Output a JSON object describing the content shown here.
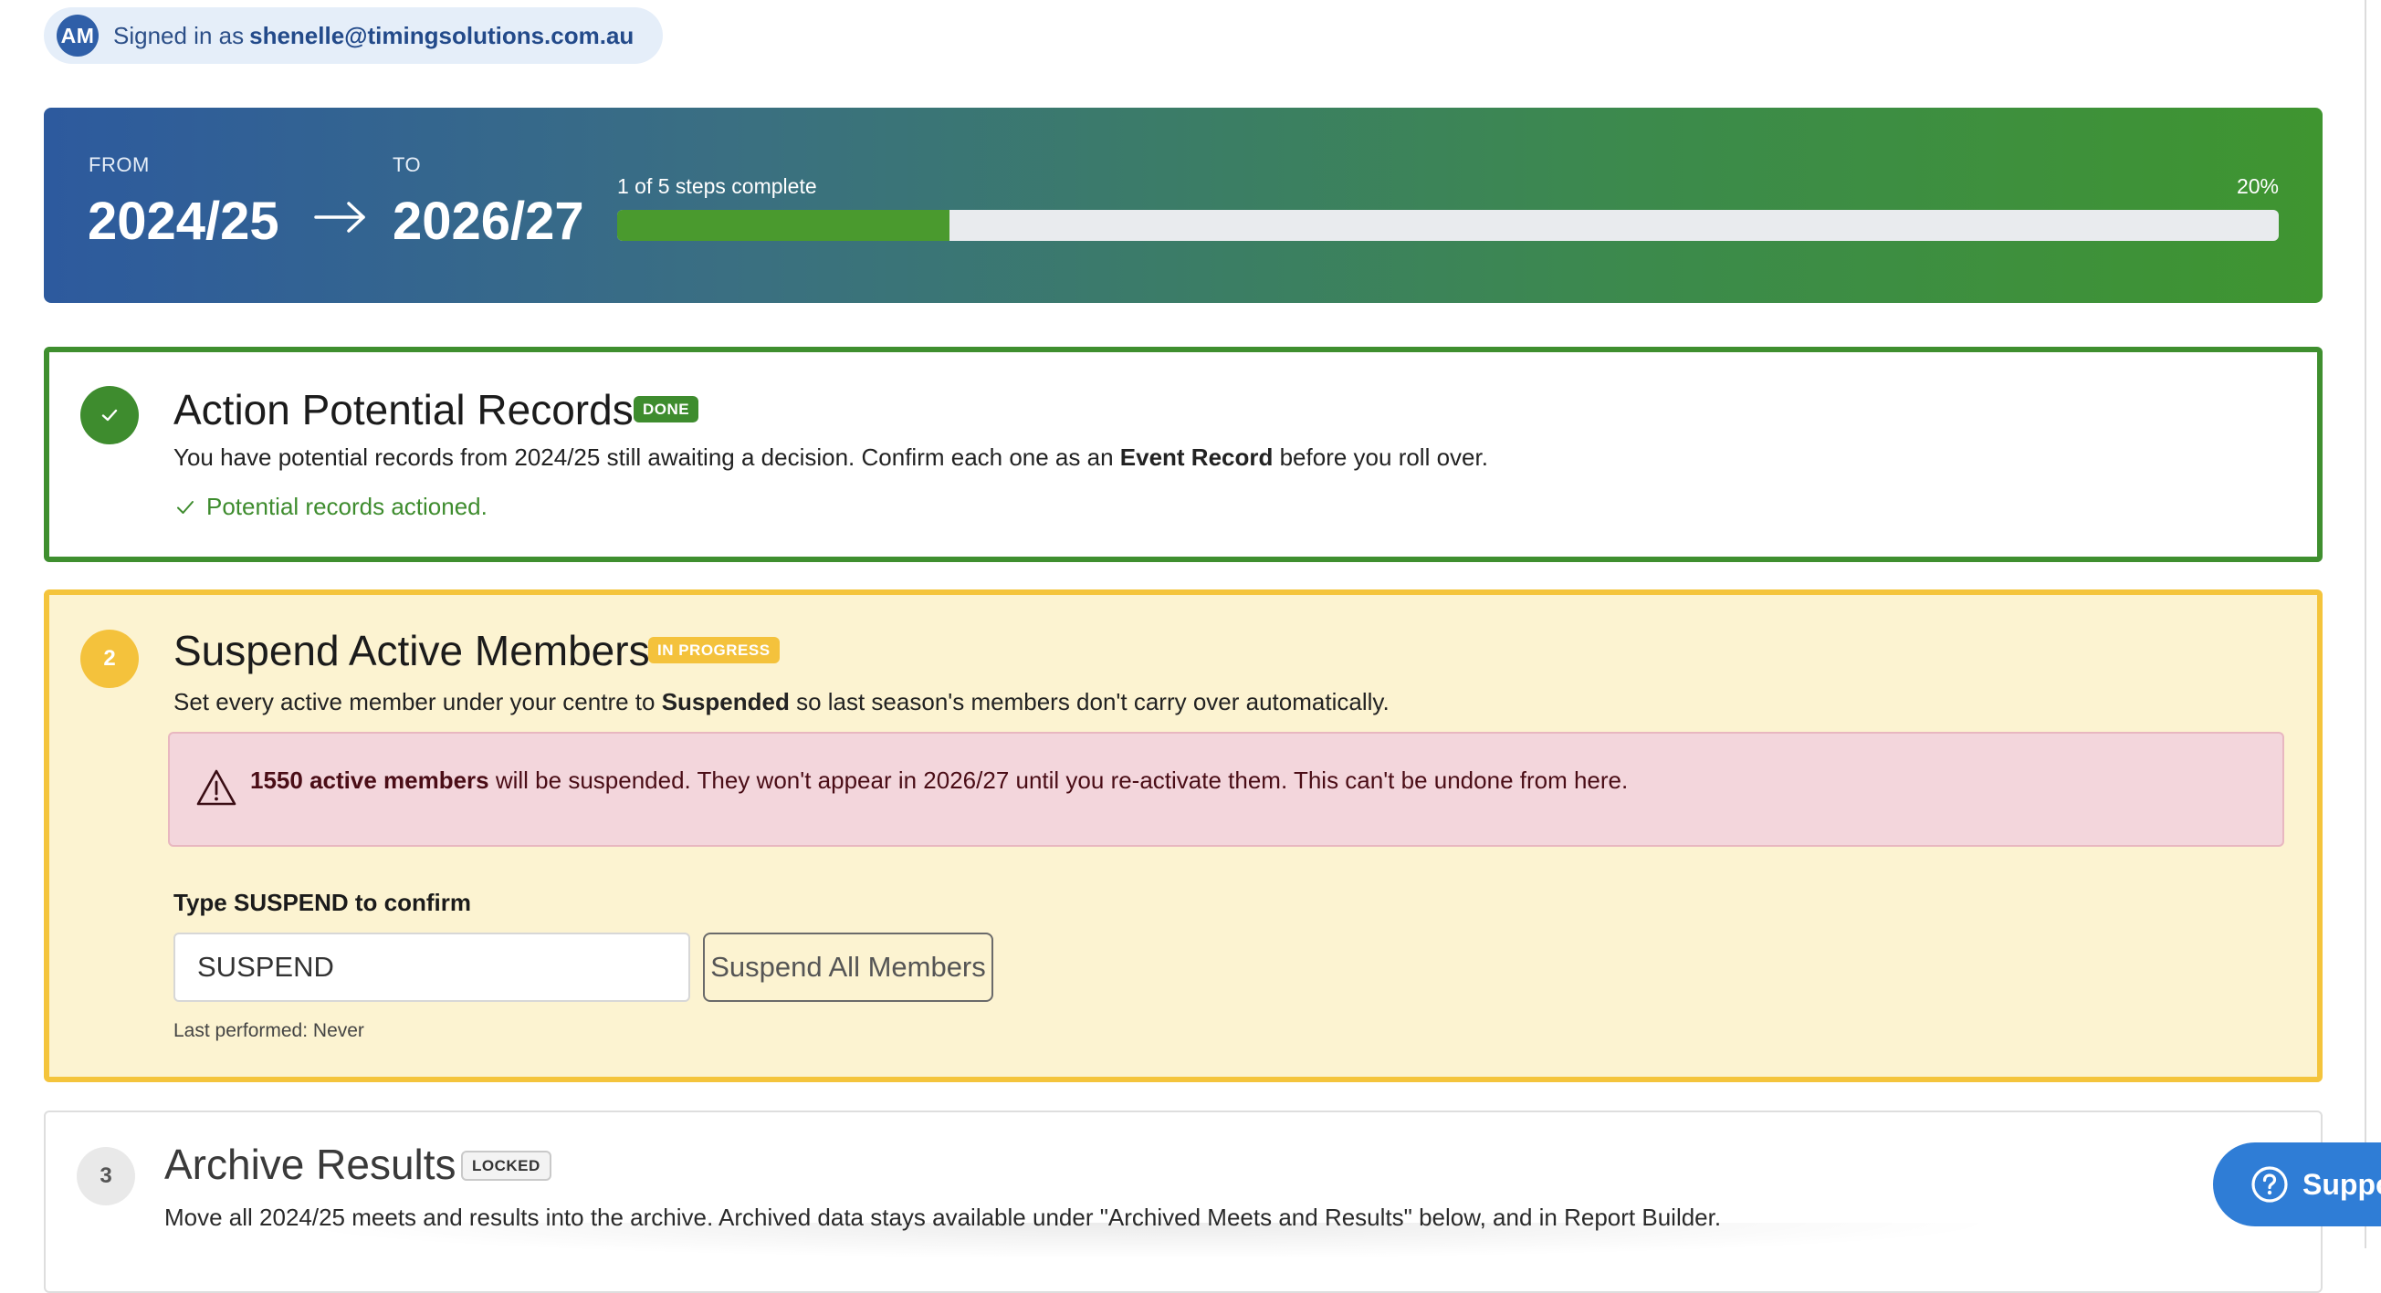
{
  "user": {
    "initials": "AM",
    "signed_in_prefix": "Signed in as",
    "email": "shenelle@timingsolutions.com.au"
  },
  "rollover": {
    "from_label": "FROM",
    "from_year": "2024/25",
    "to_label": "TO",
    "to_year": "2026/27",
    "progress_text": "1 of 5 steps complete",
    "progress_percent_text": "20%",
    "progress_fraction": 0.2,
    "colors": {
      "banner_start": "#2d5a9e",
      "banner_end": "#3f9530",
      "progress_fill": "#4a9a2e"
    }
  },
  "steps": [
    {
      "number": "1",
      "title": "Action Potential Records",
      "status": "DONE",
      "status_color": "#3e8c2e",
      "description": {
        "before": "You have potential records from 2024/25 still awaiting a decision. Confirm each one as an ",
        "bold": "Event Record",
        "after": " before you roll over."
      },
      "success_message": "Potential records actioned."
    },
    {
      "number": "2",
      "title": "Suspend Active Members",
      "status": "IN PROGRESS",
      "status_color": "#f4c23c",
      "description": {
        "before": "Set every active member under your centre to ",
        "bold": "Suspended",
        "after": " so last season's members don't carry over automatically."
      },
      "warning": {
        "bold": "1550 active members",
        "text": " will be suspended. They won't appear in 2026/27 until you re-activate them. This can't be undone from here."
      },
      "confirm_label": "Type SUSPEND to confirm",
      "confirm_value": "SUSPEND",
      "action_button": "Suspend All Members",
      "last_performed": "Last performed: Never"
    },
    {
      "number": "3",
      "title": "Archive Results",
      "status": "LOCKED",
      "description": "Move all 2024/25 meets and results into the archive. Archived data stays available under \"Archived Meets and Results\" below, and in Report Builder."
    }
  ],
  "support": {
    "label": "Suppo",
    "icon": "help-circle-icon"
  }
}
